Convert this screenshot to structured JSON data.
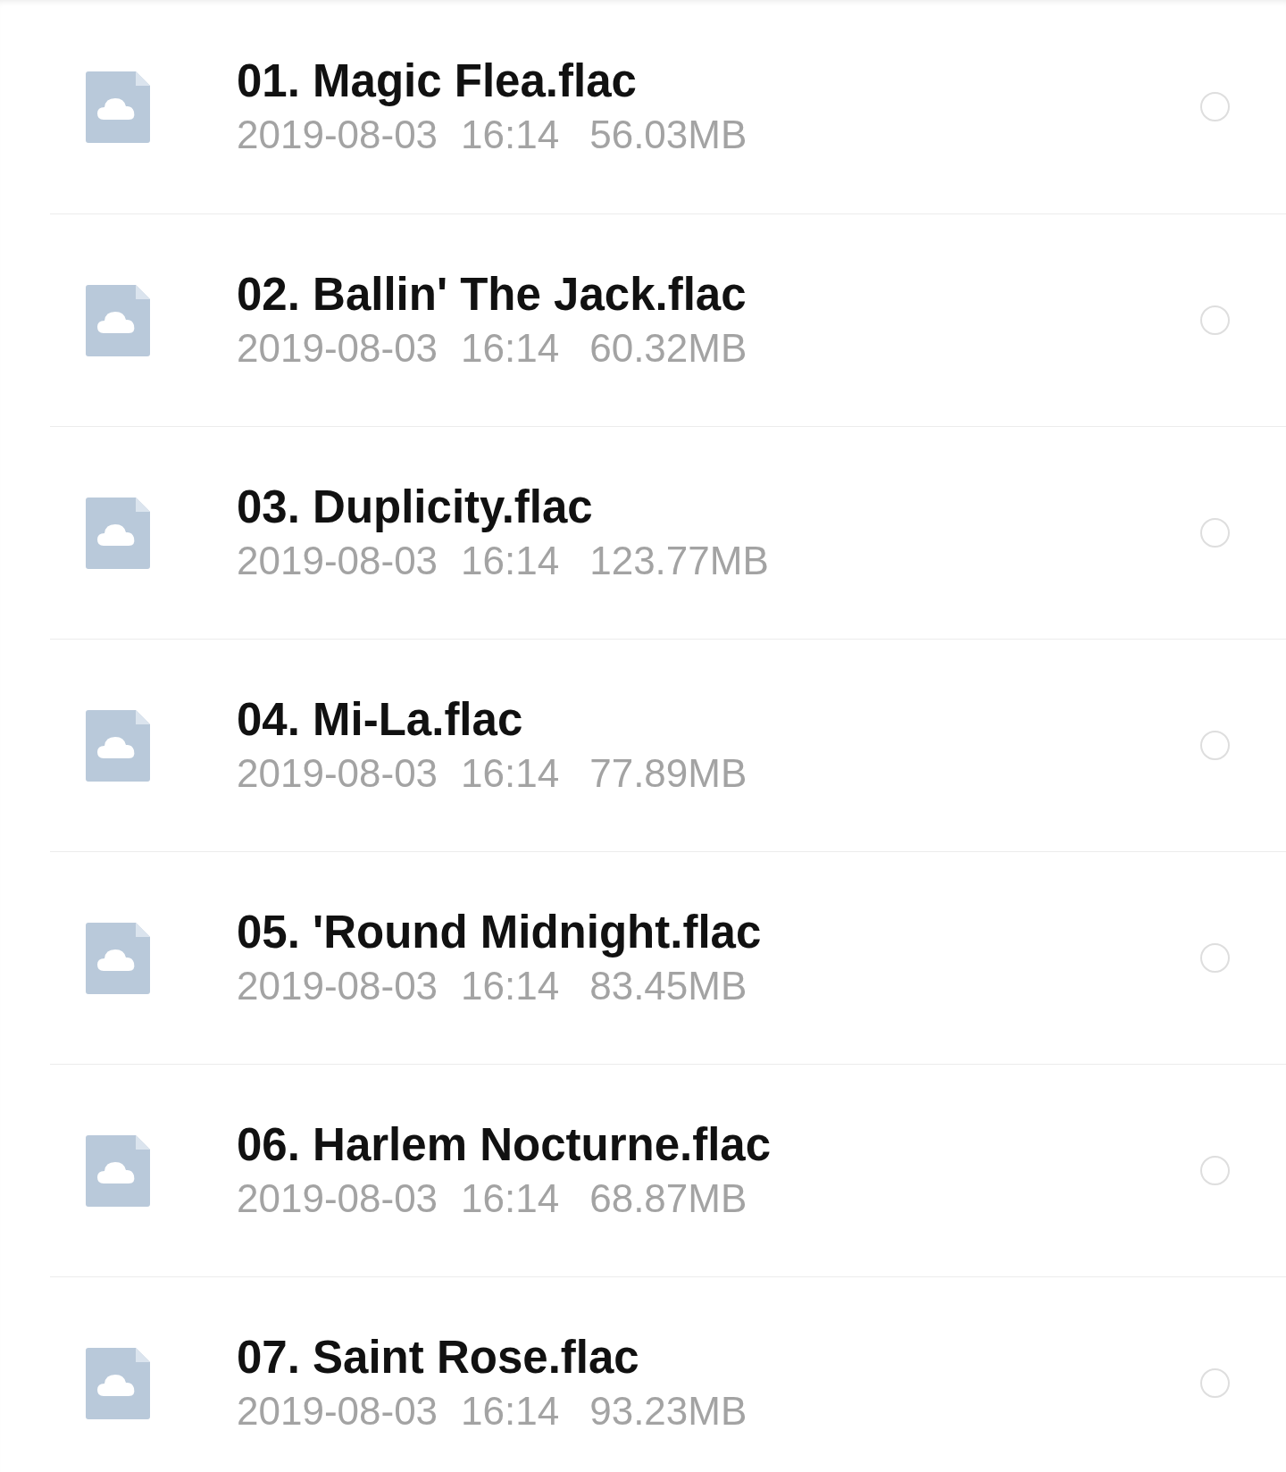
{
  "files": [
    {
      "name": "01. Magic Flea.flac",
      "date": "2019-08-03",
      "time": "16:14",
      "size": "56.03MB",
      "selected": false
    },
    {
      "name": "02. Ballin' The Jack.flac",
      "date": "2019-08-03",
      "time": "16:14",
      "size": "60.32MB",
      "selected": false
    },
    {
      "name": "03. Duplicity.flac",
      "date": "2019-08-03",
      "time": "16:14",
      "size": "123.77MB",
      "selected": false
    },
    {
      "name": "04. Mi-La.flac",
      "date": "2019-08-03",
      "time": "16:14",
      "size": "77.89MB",
      "selected": false
    },
    {
      "name": "05. 'Round Midnight.flac",
      "date": "2019-08-03",
      "time": "16:14",
      "size": "83.45MB",
      "selected": false
    },
    {
      "name": "06. Harlem Nocturne.flac",
      "date": "2019-08-03",
      "time": "16:14",
      "size": "68.87MB",
      "selected": false
    },
    {
      "name": "07. Saint Rose.flac",
      "date": "2019-08-03",
      "time": "16:14",
      "size": "93.23MB",
      "selected": false
    }
  ]
}
